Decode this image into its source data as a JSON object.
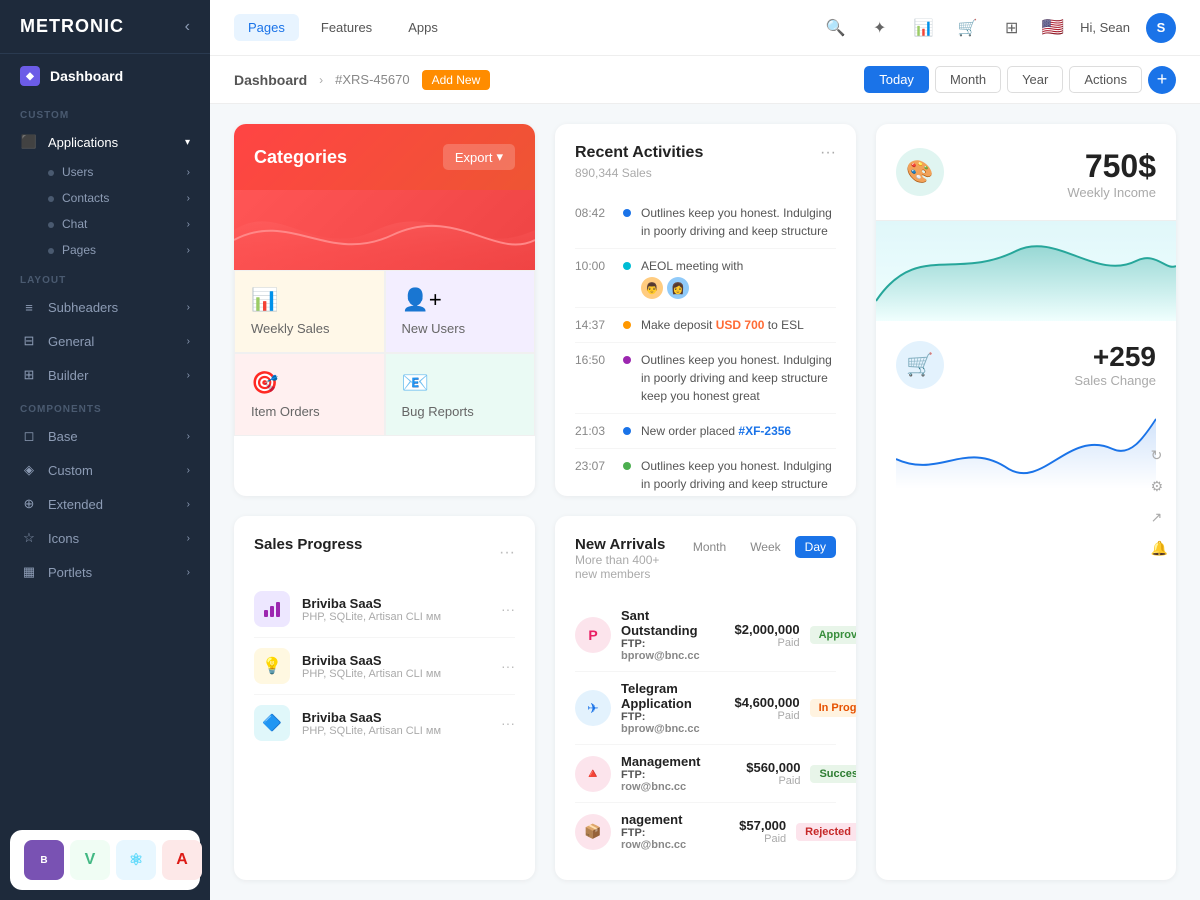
{
  "brand": {
    "name": "METRONIC"
  },
  "topnav": {
    "pages_label": "Pages",
    "features_label": "Features",
    "apps_label": "Apps",
    "user_greeting": "Hi, Sean",
    "avatar_initial": "S"
  },
  "subheader": {
    "breadcrumb": "Dashboard",
    "id": "#XRS-45670",
    "add_new": "Add New",
    "today": "Today",
    "month": "Month",
    "year": "Year",
    "actions": "Actions"
  },
  "sidebar": {
    "dashboard_label": "Dashboard",
    "custom_label": "CUSTOM",
    "applications_label": "Applications",
    "users_label": "Users",
    "contacts_label": "Contacts",
    "chat_label": "Chat",
    "pages_label": "Pages",
    "layout_label": "LAYOUT",
    "subheaders_label": "Subheaders",
    "general_label": "General",
    "builder_label": "Builder",
    "components_label": "COMPONENTS",
    "base_label": "Base",
    "custom2_label": "Custom",
    "extended_label": "Extended",
    "icons_label": "Icons",
    "portlets_label": "Portlets"
  },
  "categories": {
    "title": "Categories",
    "export_btn": "Export",
    "tiles": [
      {
        "label": "Weekly Sales",
        "icon": "📊",
        "bg": "#fff8e8"
      },
      {
        "label": "New Users",
        "icon": "👤",
        "bg": "#f3eeff"
      },
      {
        "label": "Item Orders",
        "icon": "🎯",
        "bg": "#fff0f0"
      },
      {
        "label": "Bug Reports",
        "icon": "📧",
        "bg": "#eafaf4"
      }
    ]
  },
  "activities": {
    "title": "Recent Activities",
    "subtitle": "890,344 Sales",
    "items": [
      {
        "time": "08:42",
        "dot": "blue",
        "text": "Outlines keep you honest. Indulging in poorly driving and keep structure"
      },
      {
        "time": "10:00",
        "dot": "teal",
        "text": "AEOL meeting with",
        "has_avatars": true
      },
      {
        "time": "14:37",
        "dot": "orange",
        "text": "Make deposit ",
        "link": "USD 700",
        "link_suffix": " to ESL"
      },
      {
        "time": "16:50",
        "dot": "purple",
        "text": "Outlines keep you honest. Indulging in poorly driving and keep structure keep you honest great"
      },
      {
        "time": "21:03",
        "dot": "blue",
        "text": "New order placed ",
        "link2": "#XF-2356"
      },
      {
        "time": "23:07",
        "dot": "green",
        "text": "Outlines keep you honest. Indulging in poorly driving and keep structure keep you honest and great person"
      }
    ]
  },
  "stats": {
    "income_amount": "750$",
    "income_label": "Weekly Income",
    "change_amount": "+259",
    "change_label": "Sales Change"
  },
  "sales_progress": {
    "title": "Sales Progress",
    "items": [
      {
        "name": "Briviba SaaS",
        "sub": "PHP, SQLite, Artisan CLI мм",
        "icon": "📊",
        "bg": "#ede7ff"
      },
      {
        "name": "Briviba SaaS",
        "sub": "PHP, SQLite, Artisan CLI мм",
        "icon": "💡",
        "bg": "#fff8e1"
      },
      {
        "name": "Briviba SaaS",
        "sub": "PHP, SQLite, Artisan CLI мм",
        "icon": "🔷",
        "bg": "#e0f7fa"
      }
    ]
  },
  "arrivals": {
    "title": "New Arrivals",
    "subtitle": "More than 400+ new members",
    "tabs": [
      "Month",
      "Week",
      "Day"
    ],
    "active_tab": "Day",
    "items": [
      {
        "name": "Sant Outstanding",
        "ftp": "bprow@bnc.cc",
        "price": "$2,000,000",
        "paid": "Paid",
        "badge": "Approved",
        "badge_type": "approved",
        "icon": "🅿",
        "bg": "#fce4ec"
      },
      {
        "name": "Telegram Application",
        "ftp": "bprow@bnc.cc",
        "price": "$4,600,000",
        "paid": "Paid",
        "badge": "In Progress",
        "badge_type": "progress",
        "icon": "✈",
        "bg": "#e3f2fd"
      },
      {
        "name": "Management",
        "ftp": "row@bnc.cc",
        "price": "$560,000",
        "paid": "Paid",
        "badge": "Success",
        "badge_type": "success",
        "icon": "🔺",
        "bg": "#fce4ec"
      },
      {
        "name": "nagement",
        "ftp": "row@bnc.cc",
        "price": "$57,000",
        "paid": "Paid",
        "badge": "Rejected",
        "badge_type": "rejected",
        "icon": "📦",
        "bg": "#fce4ec"
      }
    ]
  }
}
